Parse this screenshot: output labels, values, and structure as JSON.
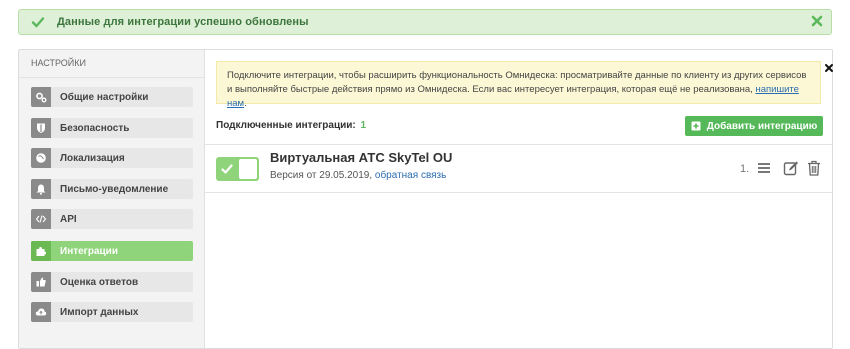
{
  "alert": {
    "message": "Данные для интеграции успешно обновлены",
    "color": "#3c763d"
  },
  "sidebar": {
    "title": "НАСТРОЙКИ",
    "items": [
      {
        "label": "Общие настройки",
        "icon": "gears-icon",
        "active": false
      },
      {
        "label": "Безопасность",
        "icon": "shield-icon",
        "active": false
      },
      {
        "label": "Локализация",
        "icon": "globe-icon",
        "active": false
      },
      {
        "label": "Письмо-уведомление",
        "icon": "bell-icon",
        "active": false
      },
      {
        "label": "API",
        "icon": "code-icon",
        "active": false
      },
      {
        "label": "Интеграции",
        "icon": "puzzle-icon",
        "active": true
      },
      {
        "label": "Оценка ответов",
        "icon": "thumbs-up-icon",
        "active": false
      },
      {
        "label": "Импорт данных",
        "icon": "cloud-upload-icon",
        "active": false
      }
    ]
  },
  "info": {
    "text": "Подключите интеграции, чтобы расширить функциональность Омнидеска: просматривайте данные по клиенту из других сервисов и выполняйте быстрые действия прямо из Омнидеска. Если вас интересует интеграция, которая ещё не реализована,",
    "link": "напишите нам",
    "end": "."
  },
  "connected": {
    "label": "Подключенные интеграции:",
    "count": "1"
  },
  "add_button": {
    "label": "Добавить интеграцию"
  },
  "integration": {
    "name": "Виртуальная АТС SkyTel OU",
    "version_prefix": "Версия от 29.05.2019,",
    "feedback_link": "обратная связь",
    "order": "1.",
    "enabled": true
  },
  "colors": {
    "accent_green": "#55b95a",
    "active_item": "#8fd37a",
    "link": "#2a6db0",
    "info_bg": "#fcf8d5"
  }
}
